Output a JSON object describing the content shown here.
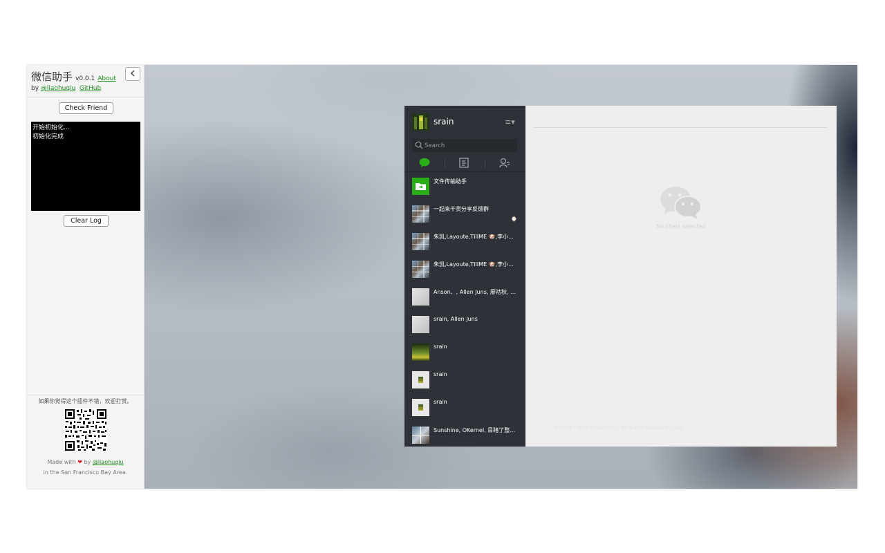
{
  "plugin": {
    "title": "微信助手",
    "version": "v0.0.1",
    "about_link": "About",
    "by_label": "by",
    "author_link": "@liaohuqiu",
    "github_link": "GitHub",
    "collapse_icon": "chevron-left-icon",
    "check_friend_button": "Check Friend",
    "log_lines": [
      "开始初始化...",
      "初始化完成"
    ],
    "clear_log_button": "Clear Log",
    "donate_text": "如果你觉得这个插件不错，欢迎打赏。",
    "made_with_prefix": "Made with",
    "made_with_by": "by",
    "made_with_author": "@liaohuqiu",
    "location_text": "in the San Francisco Bay Area."
  },
  "wechat": {
    "profile_name": "srain",
    "menu_icon": "≡▾",
    "search_placeholder": "Search",
    "tabs": [
      {
        "name": "chat-tab",
        "icon": "chat-bubble-icon",
        "active": true
      },
      {
        "name": "articles-tab",
        "icon": "document-icon",
        "active": false
      },
      {
        "name": "contacts-tab",
        "icon": "contacts-icon",
        "active": false
      }
    ],
    "chats": [
      {
        "name": "文件传输助手",
        "avatar": "file"
      },
      {
        "name": "一起来干货分享反馈群",
        "avatar": "mosaic",
        "badge": "⌚"
      },
      {
        "name": "朱凯,Layoute,TIIIME 🐶,李小...",
        "avatar": "mosaic"
      },
      {
        "name": "朱凯,Layoute,TIIIME 🐶,李小...",
        "avatar": "mosaic"
      },
      {
        "name": "Anson、, Allen Juns, 廖祜秋, A...",
        "avatar": "grey"
      },
      {
        "name": "srain, Allen Juns",
        "avatar": "grey"
      },
      {
        "name": "srain",
        "avatar": "plant"
      },
      {
        "name": "srain",
        "avatar": "small"
      },
      {
        "name": "srain",
        "avatar": "small"
      },
      {
        "name": "Sunshine, OKernel, 目睹了整个...",
        "avatar": "mix"
      }
    ],
    "empty_state": "No chats selected",
    "footer": "© 1998 - 2017 Tencent Inc. All Rights Reserved  |  Help"
  },
  "colors": {
    "wechat_green": "#2aad19",
    "sidebar_dark": "#2e3238",
    "link_green": "#1c8c1c",
    "heart_red": "#e0262b"
  }
}
